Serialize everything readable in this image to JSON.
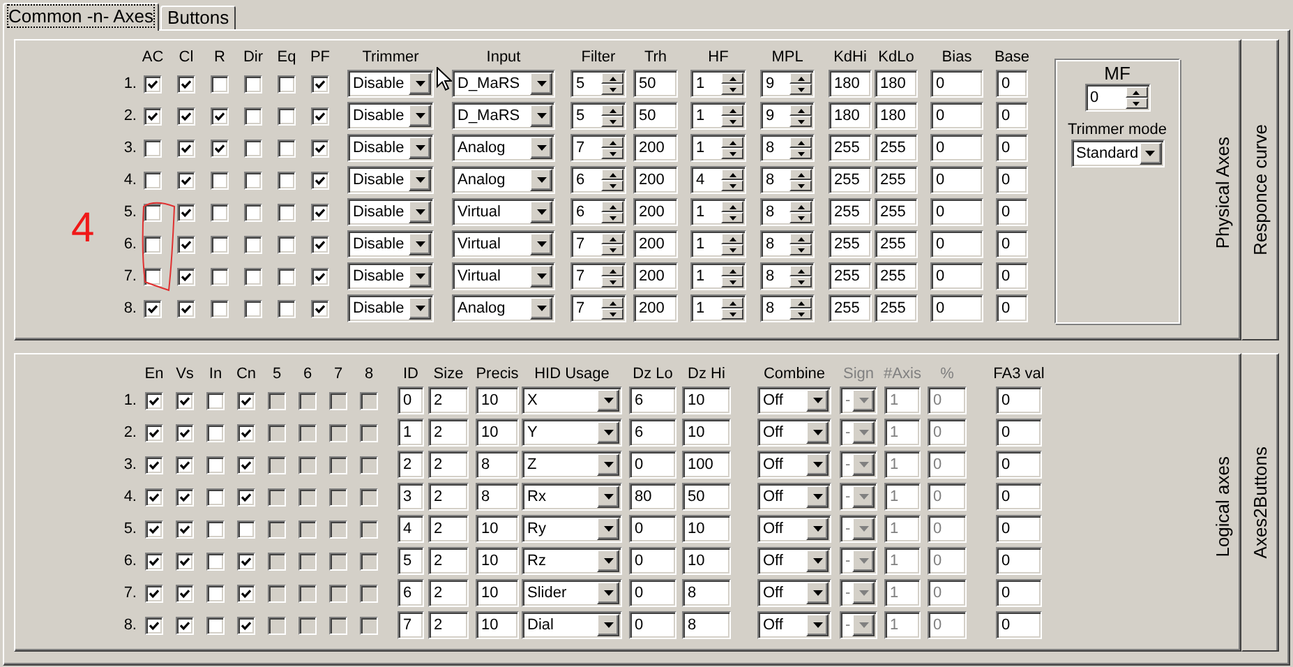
{
  "tabs": [
    {
      "label": "Common -n- Axes",
      "selected": true
    },
    {
      "label": "Buttons",
      "selected": false
    }
  ],
  "annotation": {
    "text": "4"
  },
  "physical": {
    "check_columns": [
      {
        "label": "AC"
      },
      {
        "label": "Cl"
      },
      {
        "label": "R"
      },
      {
        "label": "Dir"
      },
      {
        "label": "Eq"
      },
      {
        "label": "PF"
      }
    ],
    "field_columns": [
      {
        "label": "Trimmer",
        "kind": "combo"
      },
      {
        "label": "Input",
        "kind": "combo"
      },
      {
        "label": "Filter",
        "kind": "spin"
      },
      {
        "label": "Trh",
        "kind": "text"
      },
      {
        "label": "HF",
        "kind": "spin"
      },
      {
        "label": "MPL",
        "kind": "spin"
      },
      {
        "label": "KdHi",
        "kind": "text"
      },
      {
        "label": "KdLo",
        "kind": "text"
      },
      {
        "label": "Bias",
        "kind": "text"
      },
      {
        "label": "Base",
        "kind": "text"
      }
    ],
    "rows": [
      {
        "number": "1.",
        "checks": [
          true,
          true,
          false,
          false,
          false,
          true
        ],
        "values": [
          "Disable",
          "D_MaRS",
          "5",
          "50",
          "1",
          "9",
          "180",
          "180",
          "0",
          "0"
        ]
      },
      {
        "number": "2.",
        "checks": [
          true,
          true,
          true,
          false,
          false,
          true
        ],
        "values": [
          "Disable",
          "D_MaRS",
          "5",
          "50",
          "1",
          "9",
          "180",
          "180",
          "0",
          "0"
        ]
      },
      {
        "number": "3.",
        "checks": [
          false,
          true,
          true,
          false,
          false,
          true
        ],
        "values": [
          "Disable",
          "Analog",
          "7",
          "200",
          "1",
          "8",
          "255",
          "255",
          "0",
          "0"
        ]
      },
      {
        "number": "4.",
        "checks": [
          false,
          true,
          false,
          false,
          false,
          true
        ],
        "values": [
          "Disable",
          "Analog",
          "6",
          "200",
          "4",
          "8",
          "255",
          "255",
          "0",
          "0"
        ]
      },
      {
        "number": "5.",
        "checks": [
          false,
          true,
          false,
          false,
          false,
          true
        ],
        "values": [
          "Disable",
          "Virtual",
          "6",
          "200",
          "1",
          "8",
          "255",
          "255",
          "0",
          "0"
        ]
      },
      {
        "number": "6.",
        "checks": [
          false,
          true,
          false,
          false,
          false,
          true
        ],
        "values": [
          "Disable",
          "Virtual",
          "7",
          "200",
          "1",
          "8",
          "255",
          "255",
          "0",
          "0"
        ]
      },
      {
        "number": "7.",
        "checks": [
          false,
          true,
          false,
          false,
          false,
          true
        ],
        "values": [
          "Disable",
          "Virtual",
          "7",
          "200",
          "1",
          "8",
          "255",
          "255",
          "0",
          "0"
        ]
      },
      {
        "number": "8.",
        "checks": [
          true,
          true,
          false,
          false,
          false,
          true
        ],
        "values": [
          "Disable",
          "Analog",
          "7",
          "200",
          "1",
          "8",
          "255",
          "255",
          "0",
          "0"
        ]
      }
    ],
    "mf": {
      "label": "MF",
      "value": "0"
    },
    "trimmer_mode": {
      "label": "Trimmer mode",
      "value": "Standard"
    },
    "side_tabs": [
      {
        "label": "Physical Axes",
        "selected": true
      },
      {
        "label": "Responce curve",
        "selected": false
      }
    ]
  },
  "logical": {
    "check_columns": [
      {
        "label": "En",
        "disabled": false
      },
      {
        "label": "Vs",
        "disabled": false
      },
      {
        "label": "In",
        "disabled": false
      },
      {
        "label": "Cn",
        "disabled": false
      },
      {
        "label": "5",
        "disabled": true
      },
      {
        "label": "6",
        "disabled": true
      },
      {
        "label": "7",
        "disabled": true
      },
      {
        "label": "8",
        "disabled": true
      }
    ],
    "field_columns": [
      {
        "label": "ID",
        "kind": "text",
        "disabled": false
      },
      {
        "label": "Size",
        "kind": "text",
        "disabled": false
      },
      {
        "label": "Precis",
        "kind": "text",
        "disabled": false
      },
      {
        "label": "HID Usage",
        "kind": "combo",
        "disabled": false
      },
      {
        "label": "Dz Lo",
        "kind": "text",
        "disabled": false
      },
      {
        "label": "Dz Hi",
        "kind": "text",
        "disabled": false
      },
      {
        "label": "Combine",
        "kind": "combo",
        "disabled": false
      },
      {
        "label": "Sign",
        "kind": "combo",
        "disabled": true
      },
      {
        "label": "#Axis",
        "kind": "text",
        "disabled": true
      },
      {
        "label": "%",
        "kind": "text",
        "disabled": true
      },
      {
        "label": "FA3 val",
        "kind": "text",
        "disabled": false
      }
    ],
    "rows": [
      {
        "number": "1.",
        "checks": [
          true,
          true,
          false,
          true,
          false,
          false,
          false,
          false
        ],
        "values": [
          "0",
          "2",
          "10",
          "X",
          "6",
          "10",
          "Off",
          "-",
          "1",
          "0",
          "0"
        ]
      },
      {
        "number": "2.",
        "checks": [
          true,
          true,
          false,
          true,
          false,
          false,
          false,
          false
        ],
        "values": [
          "1",
          "2",
          "10",
          "Y",
          "6",
          "10",
          "Off",
          "-",
          "1",
          "0",
          "0"
        ]
      },
      {
        "number": "3.",
        "checks": [
          true,
          true,
          false,
          true,
          false,
          false,
          false,
          false
        ],
        "values": [
          "2",
          "2",
          "8",
          "Z",
          "0",
          "100",
          "Off",
          "-",
          "1",
          "0",
          "0"
        ]
      },
      {
        "number": "4.",
        "checks": [
          true,
          true,
          false,
          true,
          false,
          false,
          false,
          false
        ],
        "values": [
          "3",
          "2",
          "8",
          "Rx",
          "80",
          "50",
          "Off",
          "-",
          "1",
          "0",
          "0"
        ]
      },
      {
        "number": "5.",
        "checks": [
          true,
          true,
          false,
          false,
          false,
          false,
          false,
          false
        ],
        "values": [
          "4",
          "2",
          "10",
          "Ry",
          "0",
          "10",
          "Off",
          "-",
          "1",
          "0",
          "0"
        ]
      },
      {
        "number": "6.",
        "checks": [
          true,
          true,
          false,
          true,
          false,
          false,
          false,
          false
        ],
        "values": [
          "5",
          "2",
          "10",
          "Rz",
          "0",
          "10",
          "Off",
          "-",
          "1",
          "0",
          "0"
        ]
      },
      {
        "number": "7.",
        "checks": [
          true,
          true,
          false,
          true,
          false,
          false,
          false,
          false
        ],
        "values": [
          "6",
          "2",
          "10",
          "Slider",
          "0",
          "8",
          "Off",
          "-",
          "1",
          "0",
          "0"
        ]
      },
      {
        "number": "8.",
        "checks": [
          true,
          true,
          false,
          true,
          false,
          false,
          false,
          false
        ],
        "values": [
          "7",
          "2",
          "10",
          "Dial",
          "0",
          "8",
          "Off",
          "-",
          "1",
          "0",
          "0"
        ]
      }
    ],
    "side_tabs": [
      {
        "label": "Logical axes",
        "selected": true
      },
      {
        "label": "Axes2Buttons",
        "selected": false
      }
    ]
  }
}
